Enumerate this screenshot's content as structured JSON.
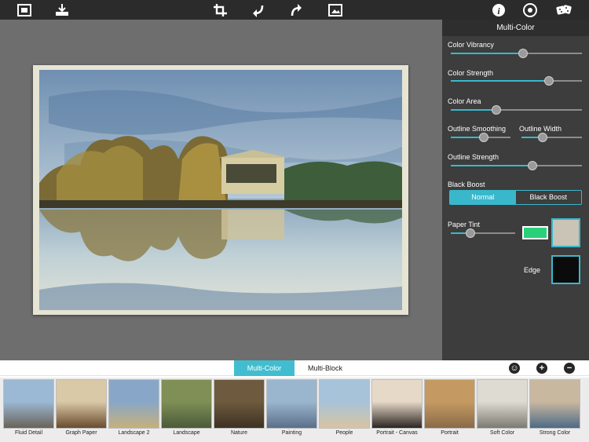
{
  "toolbar": {
    "icons": [
      "gallery-icon",
      "save-icon",
      "crop-icon",
      "undo-icon",
      "redo-icon",
      "compare-icon",
      "info-icon",
      "settings-icon",
      "random-dice-icon"
    ]
  },
  "panel": {
    "title": "Multi-Color",
    "controls": [
      {
        "label": "Color Vibrancy",
        "value": 0.55
      },
      {
        "label": "Color Strength",
        "value": 0.75
      },
      {
        "label": "Color Area",
        "value": 0.35
      },
      {
        "label": "Outline Smoothing",
        "value": 0.55
      },
      {
        "label": "Outline Width",
        "value": 0.35
      },
      {
        "label": "Outline Strength",
        "value": 0.62
      }
    ],
    "black_boost": {
      "label": "Black Boost",
      "options": [
        "Normal",
        "Black Boost"
      ],
      "selected": "Normal"
    },
    "paper_tint": {
      "label": "Paper Tint",
      "value": 0.3,
      "tint_color": "#2ad07a",
      "paper_color": "#c9c4b6"
    },
    "edge": {
      "label": "Edge",
      "color": "#0b0b0b"
    }
  },
  "tabs": [
    {
      "label": "Multi-Color",
      "active": true
    },
    {
      "label": "Multi-Block",
      "active": false
    }
  ],
  "presets": [
    {
      "label": "Fluid Detail",
      "sky": "#9bb9d4",
      "ground": "#6a6258"
    },
    {
      "label": "Graph Paper",
      "sky": "#d9c9a6",
      "ground": "#6b4b2e"
    },
    {
      "label": "Landscape 2",
      "sky": "#88a7c8",
      "ground": "#c7b07a"
    },
    {
      "label": "Landscape",
      "sky": "#7f8f55",
      "ground": "#4b5a3a"
    },
    {
      "label": "Nature",
      "sky": "#6e5a3e",
      "ground": "#3e3122"
    },
    {
      "label": "Painting",
      "sky": "#9ab6cf",
      "ground": "#5b6f8a"
    },
    {
      "label": "People",
      "sky": "#a7c3d9",
      "ground": "#d8c4a2"
    },
    {
      "label": "Portrait - Canvas",
      "sky": "#e7d9c8",
      "ground": "#2b2522"
    },
    {
      "label": "Portrait",
      "sky": "#c59a62",
      "ground": "#8a6a48"
    },
    {
      "label": "Soft Color",
      "sky": "#dedbd3",
      "ground": "#7d7a72"
    },
    {
      "label": "Strong Color",
      "sky": "#c9b8a0",
      "ground": "#4e6a86"
    }
  ],
  "colors": {
    "accent": "#3ab8cb",
    "panel_bg": "#3d3d3d",
    "toolbar_bg": "#2b2b2b"
  }
}
